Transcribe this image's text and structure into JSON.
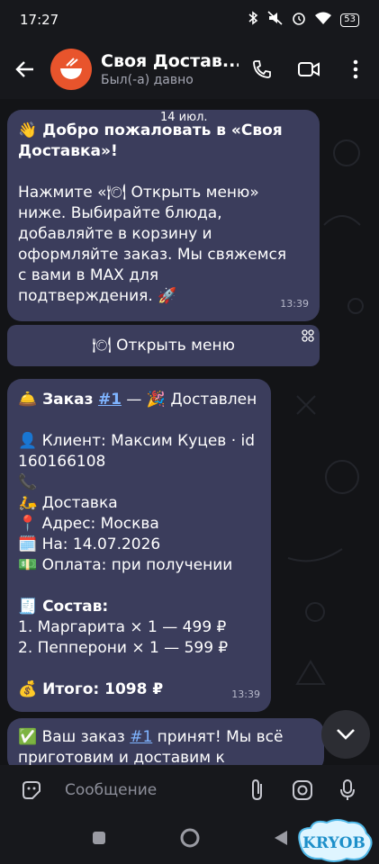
{
  "status": {
    "time": "17:27",
    "battery": "53"
  },
  "header": {
    "title": "Своя Достав...",
    "subtitle": "Был(-а) давно"
  },
  "date_divider": "14 июл.",
  "messages": [
    {
      "lines": [
        "👋 Добро пожаловать в «Своя",
        "Доставка»!",
        "",
        "Нажмите «🍽 Открыть меню»",
        "ниже. Выбирайте блюда,",
        "добавляйте в корзину и",
        "оформляйте заказ. Мы свяжемся",
        "с вами в MAX для",
        "подтверждения. 🚀"
      ],
      "time": "13:39"
    },
    {
      "order_prefix": "🛎️ Заказ",
      "order_link": "#1",
      "order_status": "— 🎉 Доставлен",
      "client_line1": "👤 Клиент: Максим Куцев · id",
      "client_line2": "160166108",
      "phone": "📞",
      "delivery": "🛵 Доставка",
      "address": "📍 Адрес: Москва",
      "date": "🗓️ На: 14.07.2026",
      "payment": "💵 Оплата: при получении",
      "items_title": "🧾 Состав:",
      "items": [
        "1. Маргарита × 1 — 499 ₽",
        "2. Пепперони × 1 — 599 ₽"
      ],
      "total": "💰 Итого: 1098 ₽",
      "time": "13:39"
    },
    {
      "prefix": "✅ Ваш заказ",
      "link": "#1",
      "line1_rest": "принят! Мы всё",
      "line2": "приготовим и доставим к"
    }
  ],
  "keyboard_button": {
    "label": "🍽 Открыть меню"
  },
  "composer": {
    "placeholder": "Сообщение"
  },
  "watermark": "KRYOB",
  "colors": {
    "bubble": "#3b3d5c",
    "link": "#7fb4ff",
    "avatar": "#e8542c"
  }
}
